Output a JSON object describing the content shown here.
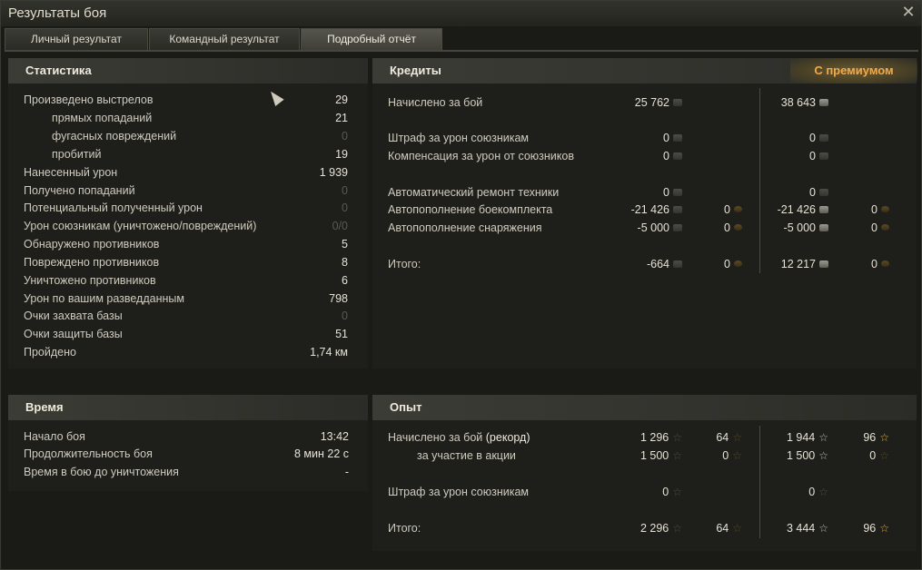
{
  "window": {
    "title": "Результаты боя"
  },
  "tabs": [
    {
      "label": "Личный результат"
    },
    {
      "label": "Командный результат"
    },
    {
      "label": "Подробный отчёт"
    }
  ],
  "stats": {
    "title": "Статистика",
    "rows": [
      {
        "label": "Произведено выстрелов",
        "value": "29"
      },
      {
        "label": "прямых попаданий",
        "value": "21"
      },
      {
        "label": "фугасных повреждений",
        "value": "0"
      },
      {
        "label": "пробитий",
        "value": "19"
      },
      {
        "label": "Нанесенный урон",
        "value": "1 939"
      },
      {
        "label": "Получено попаданий",
        "value": "0"
      },
      {
        "label": "Потенциальный полученный урон",
        "value": "0"
      },
      {
        "label": "Урон союзникам (уничтожено/повреждений)",
        "value": "0/0"
      },
      {
        "label": "Обнаружено противников",
        "value": "5"
      },
      {
        "label": "Повреждено противников",
        "value": "8"
      },
      {
        "label": "Уничтожено противников",
        "value": "6"
      },
      {
        "label": "Урон по вашим разведданным",
        "value": "798"
      },
      {
        "label": "Очки захвата базы",
        "value": "0"
      },
      {
        "label": "Очки защиты базы",
        "value": "51"
      },
      {
        "label": "Пройдено",
        "value": "1,74 км"
      }
    ]
  },
  "time": {
    "title": "Время",
    "rows": [
      {
        "label": "Начало боя",
        "value": "13:42"
      },
      {
        "label": "Продолжительность боя",
        "value": "8 мин 22 с"
      },
      {
        "label": "Время в бою до уничтожения",
        "value": "-"
      }
    ]
  },
  "credits": {
    "title": "Кредиты",
    "premium_label": "С премиумом",
    "rows": [
      {
        "label": "Начислено за бой",
        "base": "25 762",
        "base_gold": "",
        "prem": "38 643",
        "prem_gold": ""
      },
      {
        "label": "Штраф за урон союзникам",
        "base": "0",
        "base_gold": "",
        "prem": "0",
        "prem_gold": ""
      },
      {
        "label": "Компенсация за урон от союзников",
        "base": "0",
        "base_gold": "",
        "prem": "0",
        "prem_gold": ""
      },
      {
        "label": "Автоматический ремонт техники",
        "base": "0",
        "base_gold": "",
        "prem": "0",
        "prem_gold": ""
      },
      {
        "label": "Автопополнение боекомплекта",
        "base": "-21 426",
        "base_gold": "0",
        "prem": "-21 426",
        "prem_gold": "0"
      },
      {
        "label": "Автопополнение снаряжения",
        "base": "-5 000",
        "base_gold": "0",
        "prem": "-5 000",
        "prem_gold": "0"
      },
      {
        "label": "Итого:",
        "base": "-664",
        "base_gold": "0",
        "prem": "12 217",
        "prem_gold": "0"
      }
    ]
  },
  "experience": {
    "title": "Опыт",
    "rows": [
      {
        "label": "Начислено за бой",
        "label_suffix": "(рекорд)",
        "base": "1 296",
        "base_free": "64",
        "prem": "1 944",
        "prem_free": "96"
      },
      {
        "label": "за участие в акции",
        "label_suffix": "",
        "base": "1 500",
        "base_free": "0",
        "prem": "1 500",
        "prem_free": "0"
      },
      {
        "label": "Штраф за урон союзникам",
        "label_suffix": "",
        "base": "0",
        "base_free": "",
        "prem": "0",
        "prem_free": ""
      },
      {
        "label": "Итого:",
        "label_suffix": "",
        "base": "2 296",
        "base_free": "64",
        "prem": "3 444",
        "prem_free": "96"
      }
    ]
  },
  "icons": {
    "close": "close-icon",
    "credit": "credit-coin-icon",
    "gold": "gold-coin-icon",
    "xp": "xp-star-icon",
    "free_xp": "free-xp-star-icon"
  },
  "colors": {
    "accent_premium": "#f2a94a",
    "negative": "#e02a1e",
    "background": "#1a1a17"
  }
}
